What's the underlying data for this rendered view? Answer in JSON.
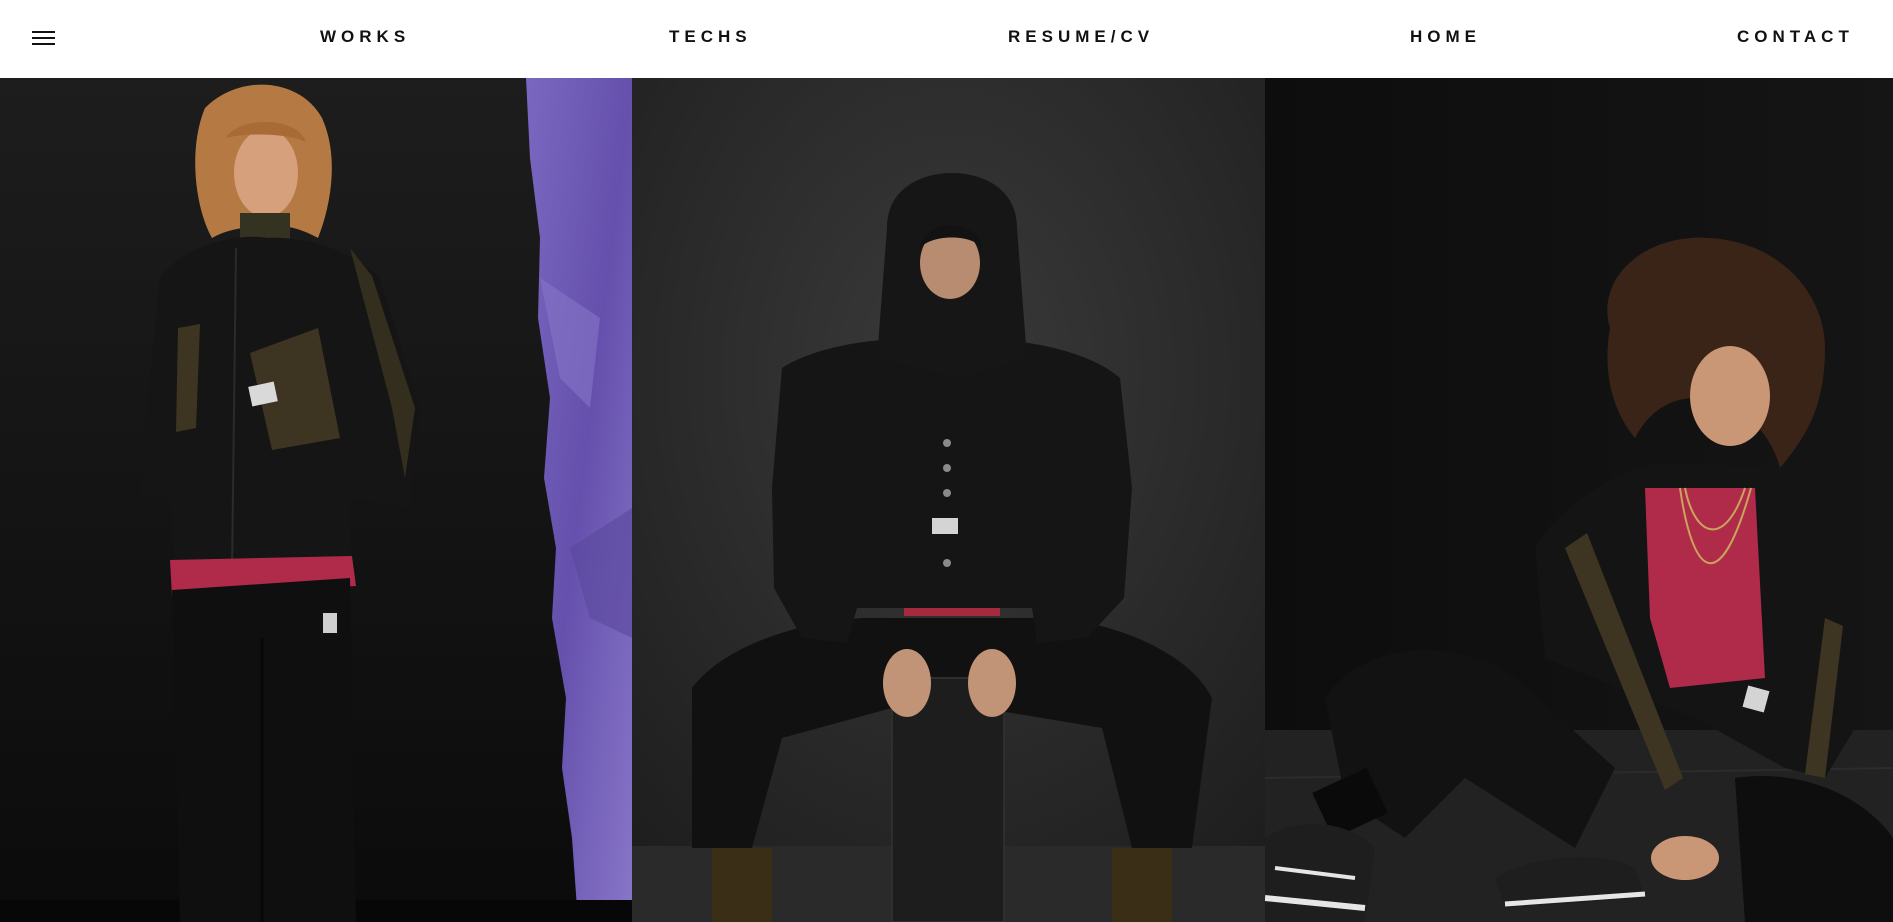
{
  "header": {
    "menu_icon": "hamburger-menu-icon",
    "nav": [
      {
        "label": "WORKS"
      },
      {
        "label": "TECHS"
      },
      {
        "label": "RESUME/CV"
      },
      {
        "label": "HOME"
      },
      {
        "label": "CONTACT"
      }
    ]
  },
  "gallery": {
    "photos": [
      {
        "subject": "model-standing-photo"
      },
      {
        "subject": "model-hooded-seated-photo"
      },
      {
        "subject": "model-floor-seated-photo"
      }
    ]
  },
  "colors": {
    "background": "#ffffff",
    "nav_text": "#111111",
    "photo_backdrop": "#1a1a1a",
    "purple_accent": "#6f5bb0",
    "jacket": "#141414",
    "olive": "#3d3522",
    "crimson": "#b02a4a"
  }
}
